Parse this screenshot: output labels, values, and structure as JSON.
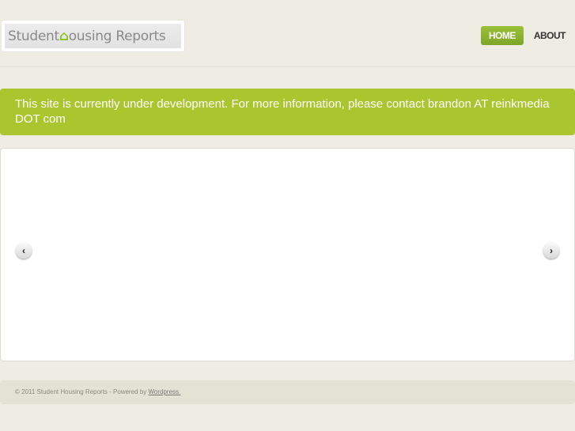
{
  "logo": {
    "text_before": "Student ",
    "text_h": "⌂",
    "text_after": "ousing Reports"
  },
  "nav": {
    "home": "HOME",
    "about": "ABOUT"
  },
  "notice": "This site is currently under development. For more information, please contact brandon AT reinkmedia DOT com",
  "slider": {
    "prev": "‹",
    "next": "›"
  },
  "footer": {
    "text": "© 2011 Student Housing Reports - Powered by ",
    "link": "Wordpress."
  }
}
